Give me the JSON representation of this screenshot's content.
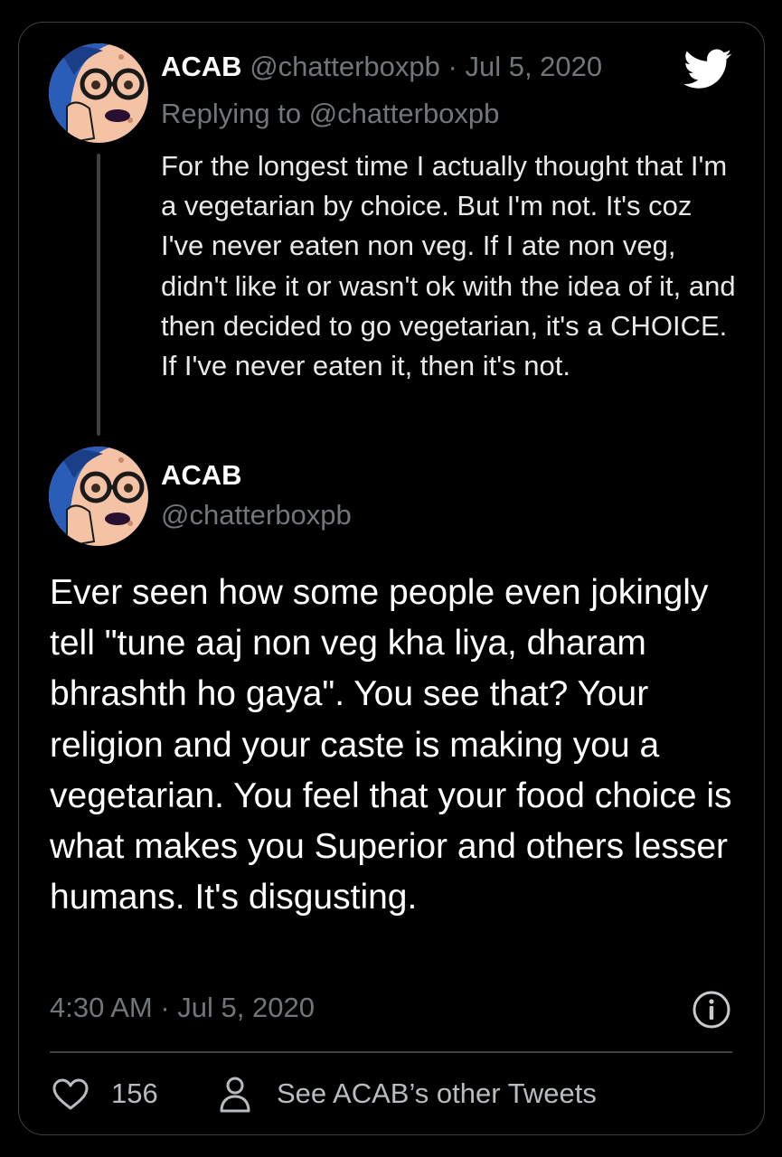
{
  "reply": {
    "name": "ACAB",
    "handle": "@chatterboxpb",
    "separator": "·",
    "date": "Jul 5, 2020",
    "replying_to": "Replying to @chatterboxpb",
    "text": "For the longest time I actually thought that I'm a vegetarian by choice. But I'm not. It's coz I've never eaten non veg. If I ate non veg, didn't like it or wasn't ok with the idea of it, and then decided to go vegetarian, it's a CHOICE. If I've never eaten it, then it's not."
  },
  "main": {
    "name": "ACAB",
    "handle": "@chatterboxpb",
    "text": "Ever seen how some people even jokingly tell \"tune aaj non veg kha liya, dharam bhrashth ho gaya\". You see that? Your religion and your caste is making you a vegetarian. You feel that your food choice is what makes you Superior and others lesser humans. It's disgusting.",
    "timestamp": "4:30 AM · Jul 5, 2020"
  },
  "footer": {
    "likes": "156",
    "other_tweets": "See ACAB’s other Tweets"
  },
  "icons": {
    "logo": "twitter-bird-icon",
    "info": "info-icon",
    "like": "heart-icon",
    "profile": "person-icon"
  },
  "colors": {
    "background": "#000000",
    "border": "#3e4144",
    "muted_text": "#71767b",
    "twitter_logo": "#ffffff",
    "avatar_hair": "#2a5db8",
    "avatar_skin": "#f4c2a4"
  }
}
